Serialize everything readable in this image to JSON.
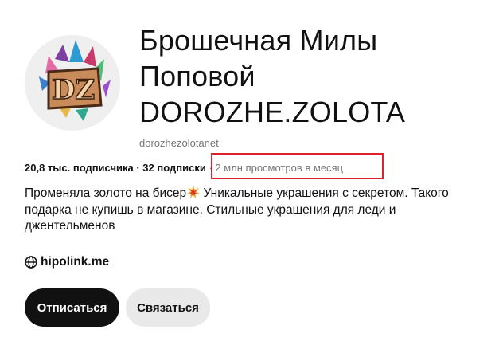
{
  "profile": {
    "name_lines": [
      "Брошечная Милы",
      "Поповой",
      "DOROZHE.ZOLOTA"
    ],
    "handle": "dorozhezolotanet",
    "avatar_icon": "crystal-logo-icon",
    "avatar_monogram": "DZ"
  },
  "stats": {
    "followers": "20,8 тыс. подписчика",
    "separator": " · ",
    "following": "32 подписки",
    "separator2": " · ",
    "monthly_views": "2 млн просмотров в месяц"
  },
  "bio": {
    "lines": [
      "Променяла золото на бисер",
      "Уникальные украшения с секретом. Такого",
      "подарка не купишь в магазине. Стильные украшения для леди и",
      "джентельменов"
    ],
    "emoji_icon": "collision-icon"
  },
  "link": {
    "icon": "globe-icon",
    "text": "hipolink.me"
  },
  "actions": {
    "unfollow_label": "Отписаться",
    "contact_label": "Связаться"
  },
  "colors": {
    "highlight": "#e0202a",
    "primary_button": "#111111",
    "secondary_button": "#e9e9e9",
    "muted_text": "#767676"
  }
}
